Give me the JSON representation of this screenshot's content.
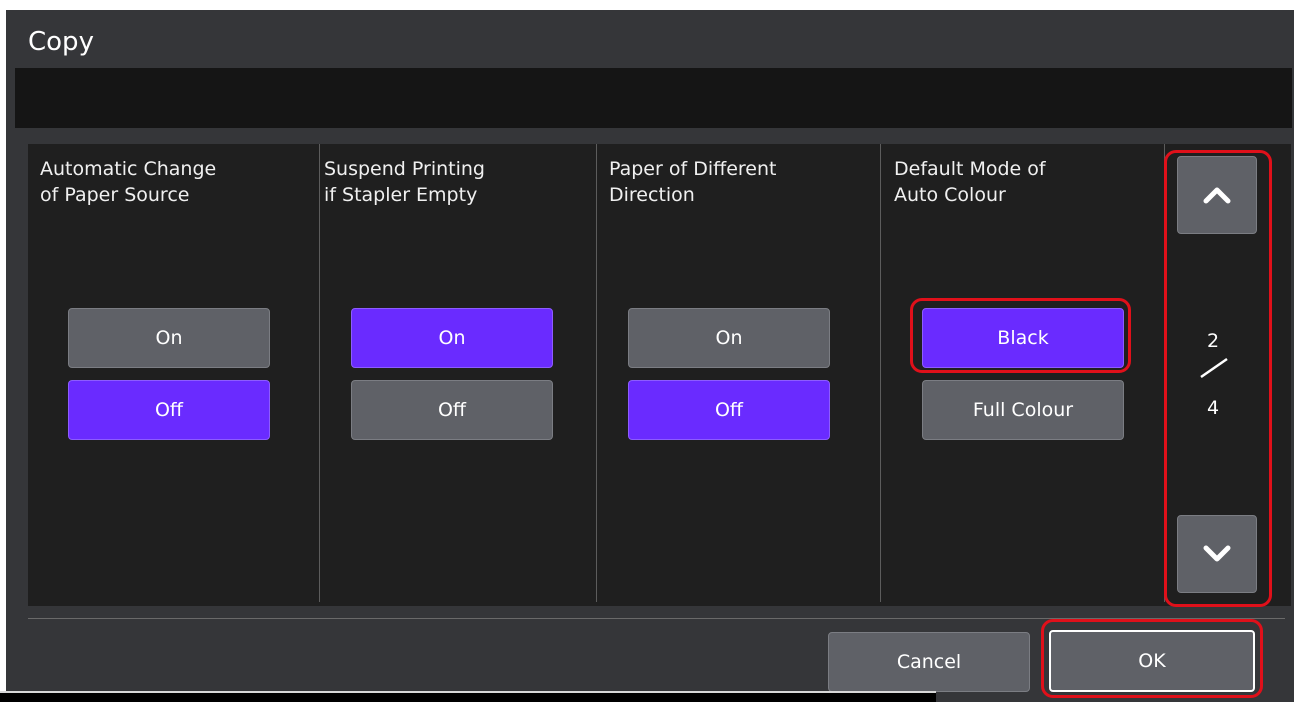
{
  "window": {
    "title": "Copy"
  },
  "message": "",
  "settings": [
    {
      "title": "Automatic Change\nof Paper Source",
      "options": [
        "On",
        "Off"
      ],
      "selected": "Off"
    },
    {
      "title": "Suspend Printing\nif Stapler Empty",
      "options": [
        "On",
        "Off"
      ],
      "selected": "On"
    },
    {
      "title": "Paper of Different\nDirection",
      "options": [
        "On",
        "Off"
      ],
      "selected": "Off"
    },
    {
      "title": "Default Mode of\nAuto Colour",
      "options": [
        "Black",
        "Full Colour"
      ],
      "selected": "Black"
    }
  ],
  "pager": {
    "current": "2",
    "total": "4",
    "up_icon": "chevron-up-icon",
    "down_icon": "chevron-down-icon"
  },
  "footer": {
    "cancel_label": "Cancel",
    "ok_label": "OK"
  },
  "colors": {
    "selected": "#6a2bff",
    "unselected": "#5f6167",
    "highlight": "#e0101a",
    "background": "#1f1f1f"
  }
}
